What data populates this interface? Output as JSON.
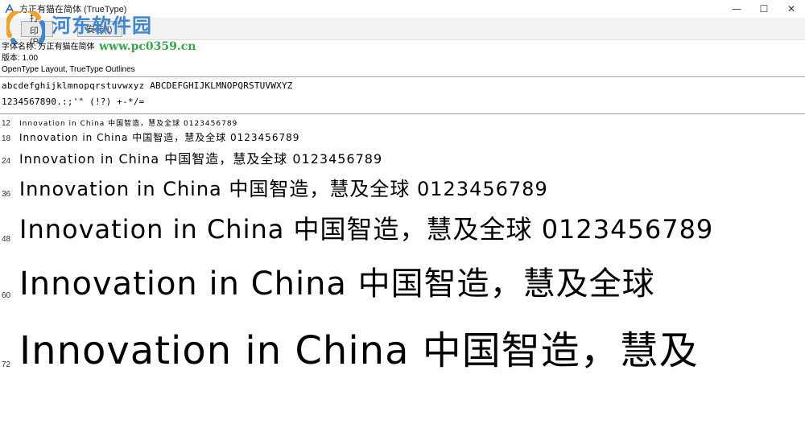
{
  "window": {
    "title": "方正有猫在简体 (TrueType)",
    "minimize": "—",
    "maximize": "☐",
    "close": "✕"
  },
  "toolbar": {
    "print_label": "打印(P)",
    "install_label": "安装(I)"
  },
  "watermark": {
    "site_name": "河东软件园",
    "site_url": "www.pc0359.cn"
  },
  "info": {
    "font_name": "字体名称: 方正有猫在简体",
    "version": "版本: 1.00",
    "type": "OpenType Layout, TrueType Outlines"
  },
  "charset": {
    "line1": "abcdefghijklmnopqrstuvwxyz ABCDEFGHIJKLMNOPQRSTUVWXYZ",
    "line2": "1234567890.:;'\" (!?) +-*/="
  },
  "samples": [
    {
      "size": "12",
      "text": "Innovation in China 中国智造，慧及全球 0123456789"
    },
    {
      "size": "18",
      "text": "Innovation in China 中国智造，慧及全球 0123456789"
    },
    {
      "size": "24",
      "text": "Innovation in China 中国智造，慧及全球 0123456789"
    },
    {
      "size": "36",
      "text": "Innovation in China 中国智造，慧及全球 0123456789"
    },
    {
      "size": "48",
      "text": "Innovation in China 中国智造，慧及全球 0123456789"
    },
    {
      "size": "60",
      "text": "Innovation in China 中国智造，慧及全球"
    },
    {
      "size": "72",
      "text": "Innovation in China 中国智造，慧及"
    }
  ],
  "colors": {
    "watermark_blue": "#3f86cf",
    "watermark_green": "#3aa64a"
  }
}
